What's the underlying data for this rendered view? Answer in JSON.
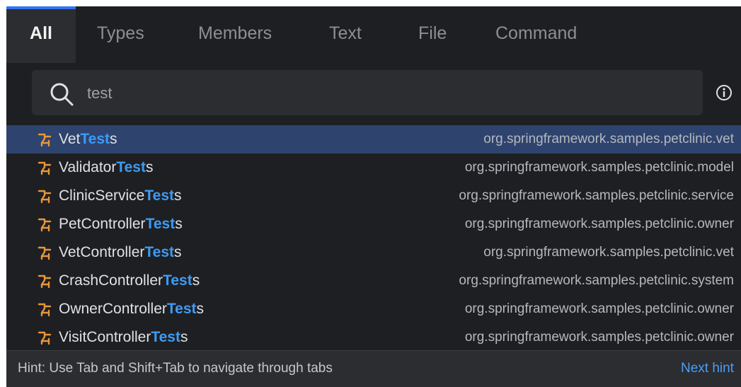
{
  "tabs": [
    {
      "label": "All",
      "active": true
    },
    {
      "label": "Types"
    },
    {
      "label": "Members"
    },
    {
      "label": "Text"
    },
    {
      "label": "File"
    },
    {
      "label": "Command"
    }
  ],
  "search": {
    "value": "test",
    "icon": "search-icon"
  },
  "results": [
    {
      "prefix": "Vet",
      "match": "Test",
      "suffix": "s",
      "package": "org.springframework.samples.petclinic.vet",
      "selected": true
    },
    {
      "prefix": "Validator",
      "match": "Test",
      "suffix": "s",
      "package": "org.springframework.samples.petclinic.model"
    },
    {
      "prefix": "ClinicService",
      "match": "Test",
      "suffix": "s",
      "package": "org.springframework.samples.petclinic.service"
    },
    {
      "prefix": "PetController",
      "match": "Test",
      "suffix": "s",
      "package": "org.springframework.samples.petclinic.owner"
    },
    {
      "prefix": "VetController",
      "match": "Test",
      "suffix": "s",
      "package": "org.springframework.samples.petclinic.vet"
    },
    {
      "prefix": "CrashController",
      "match": "Test",
      "suffix": "s",
      "package": "org.springframework.samples.petclinic.system"
    },
    {
      "prefix": "OwnerController",
      "match": "Test",
      "suffix": "s",
      "package": "org.springframework.samples.petclinic.owner"
    },
    {
      "prefix": "VisitController",
      "match": "Test",
      "suffix": "s",
      "package": "org.springframework.samples.petclinic.owner"
    }
  ],
  "footer": {
    "hint": "Hint: Use Tab and Shift+Tab to navigate through tabs",
    "next_hint": "Next hint"
  },
  "colors": {
    "background": "#1e1f22",
    "accent": "#3574f0",
    "match": "#3d9bf5",
    "selected_row": "#2e436e",
    "class_icon": "#e8963c"
  }
}
